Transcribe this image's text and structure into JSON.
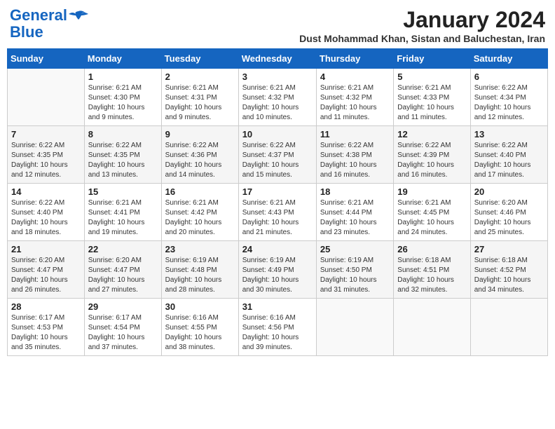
{
  "header": {
    "logo_line1": "General",
    "logo_line2": "Blue",
    "month_title": "January 2024",
    "location": "Dust Mohammad Khan, Sistan and Baluchestan, Iran"
  },
  "weekdays": [
    "Sunday",
    "Monday",
    "Tuesday",
    "Wednesday",
    "Thursday",
    "Friday",
    "Saturday"
  ],
  "weeks": [
    [
      {
        "day": "",
        "info": ""
      },
      {
        "day": "1",
        "info": "Sunrise: 6:21 AM\nSunset: 4:30 PM\nDaylight: 10 hours\nand 9 minutes."
      },
      {
        "day": "2",
        "info": "Sunrise: 6:21 AM\nSunset: 4:31 PM\nDaylight: 10 hours\nand 9 minutes."
      },
      {
        "day": "3",
        "info": "Sunrise: 6:21 AM\nSunset: 4:32 PM\nDaylight: 10 hours\nand 10 minutes."
      },
      {
        "day": "4",
        "info": "Sunrise: 6:21 AM\nSunset: 4:32 PM\nDaylight: 10 hours\nand 11 minutes."
      },
      {
        "day": "5",
        "info": "Sunrise: 6:21 AM\nSunset: 4:33 PM\nDaylight: 10 hours\nand 11 minutes."
      },
      {
        "day": "6",
        "info": "Sunrise: 6:22 AM\nSunset: 4:34 PM\nDaylight: 10 hours\nand 12 minutes."
      }
    ],
    [
      {
        "day": "7",
        "info": "Sunrise: 6:22 AM\nSunset: 4:35 PM\nDaylight: 10 hours\nand 12 minutes."
      },
      {
        "day": "8",
        "info": "Sunrise: 6:22 AM\nSunset: 4:35 PM\nDaylight: 10 hours\nand 13 minutes."
      },
      {
        "day": "9",
        "info": "Sunrise: 6:22 AM\nSunset: 4:36 PM\nDaylight: 10 hours\nand 14 minutes."
      },
      {
        "day": "10",
        "info": "Sunrise: 6:22 AM\nSunset: 4:37 PM\nDaylight: 10 hours\nand 15 minutes."
      },
      {
        "day": "11",
        "info": "Sunrise: 6:22 AM\nSunset: 4:38 PM\nDaylight: 10 hours\nand 16 minutes."
      },
      {
        "day": "12",
        "info": "Sunrise: 6:22 AM\nSunset: 4:39 PM\nDaylight: 10 hours\nand 16 minutes."
      },
      {
        "day": "13",
        "info": "Sunrise: 6:22 AM\nSunset: 4:40 PM\nDaylight: 10 hours\nand 17 minutes."
      }
    ],
    [
      {
        "day": "14",
        "info": "Sunrise: 6:22 AM\nSunset: 4:40 PM\nDaylight: 10 hours\nand 18 minutes."
      },
      {
        "day": "15",
        "info": "Sunrise: 6:21 AM\nSunset: 4:41 PM\nDaylight: 10 hours\nand 19 minutes."
      },
      {
        "day": "16",
        "info": "Sunrise: 6:21 AM\nSunset: 4:42 PM\nDaylight: 10 hours\nand 20 minutes."
      },
      {
        "day": "17",
        "info": "Sunrise: 6:21 AM\nSunset: 4:43 PM\nDaylight: 10 hours\nand 21 minutes."
      },
      {
        "day": "18",
        "info": "Sunrise: 6:21 AM\nSunset: 4:44 PM\nDaylight: 10 hours\nand 23 minutes."
      },
      {
        "day": "19",
        "info": "Sunrise: 6:21 AM\nSunset: 4:45 PM\nDaylight: 10 hours\nand 24 minutes."
      },
      {
        "day": "20",
        "info": "Sunrise: 6:20 AM\nSunset: 4:46 PM\nDaylight: 10 hours\nand 25 minutes."
      }
    ],
    [
      {
        "day": "21",
        "info": "Sunrise: 6:20 AM\nSunset: 4:47 PM\nDaylight: 10 hours\nand 26 minutes."
      },
      {
        "day": "22",
        "info": "Sunrise: 6:20 AM\nSunset: 4:47 PM\nDaylight: 10 hours\nand 27 minutes."
      },
      {
        "day": "23",
        "info": "Sunrise: 6:19 AM\nSunset: 4:48 PM\nDaylight: 10 hours\nand 28 minutes."
      },
      {
        "day": "24",
        "info": "Sunrise: 6:19 AM\nSunset: 4:49 PM\nDaylight: 10 hours\nand 30 minutes."
      },
      {
        "day": "25",
        "info": "Sunrise: 6:19 AM\nSunset: 4:50 PM\nDaylight: 10 hours\nand 31 minutes."
      },
      {
        "day": "26",
        "info": "Sunrise: 6:18 AM\nSunset: 4:51 PM\nDaylight: 10 hours\nand 32 minutes."
      },
      {
        "day": "27",
        "info": "Sunrise: 6:18 AM\nSunset: 4:52 PM\nDaylight: 10 hours\nand 34 minutes."
      }
    ],
    [
      {
        "day": "28",
        "info": "Sunrise: 6:17 AM\nSunset: 4:53 PM\nDaylight: 10 hours\nand 35 minutes."
      },
      {
        "day": "29",
        "info": "Sunrise: 6:17 AM\nSunset: 4:54 PM\nDaylight: 10 hours\nand 37 minutes."
      },
      {
        "day": "30",
        "info": "Sunrise: 6:16 AM\nSunset: 4:55 PM\nDaylight: 10 hours\nand 38 minutes."
      },
      {
        "day": "31",
        "info": "Sunrise: 6:16 AM\nSunset: 4:56 PM\nDaylight: 10 hours\nand 39 minutes."
      },
      {
        "day": "",
        "info": ""
      },
      {
        "day": "",
        "info": ""
      },
      {
        "day": "",
        "info": ""
      }
    ]
  ]
}
